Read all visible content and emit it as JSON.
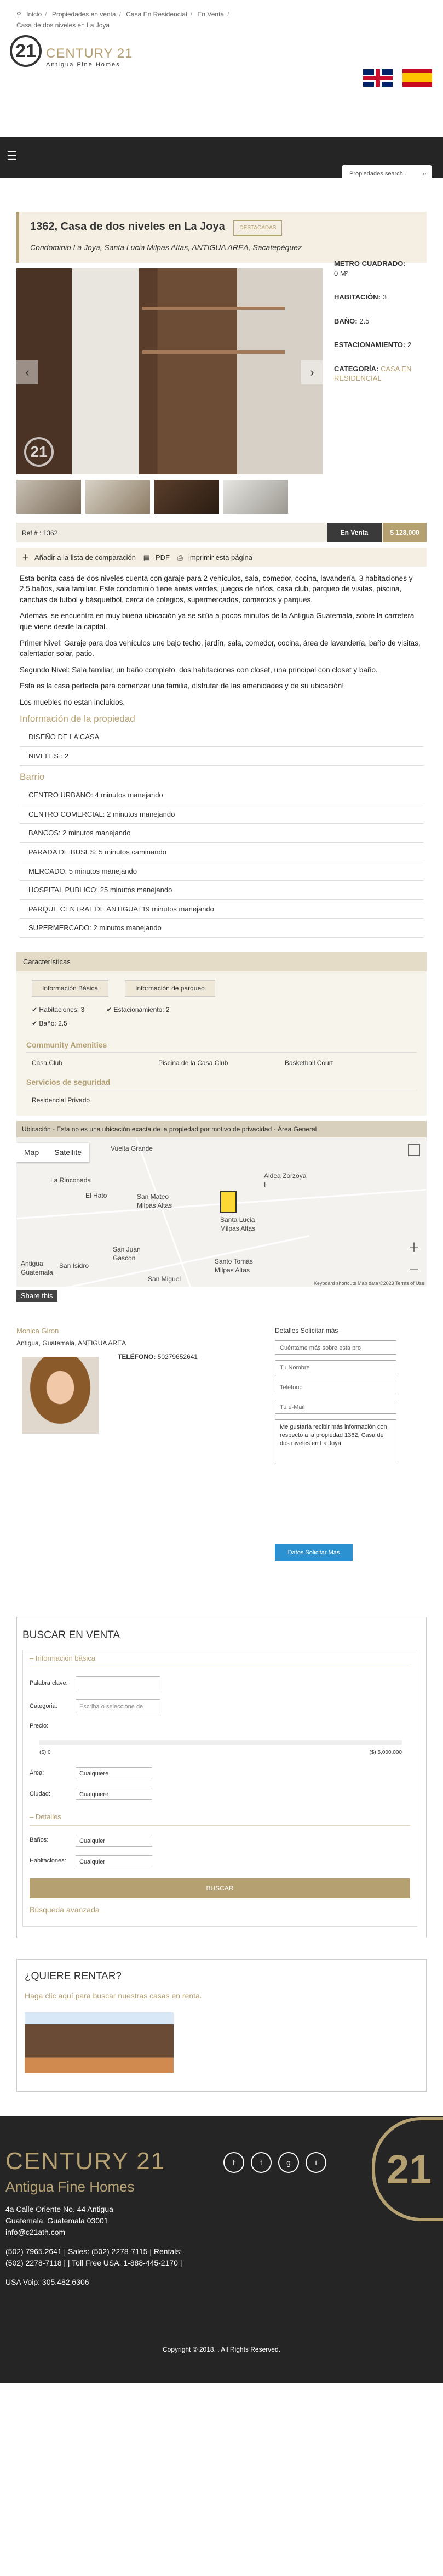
{
  "breadcrumb": {
    "home": "Inicio",
    "items": [
      "Propiedades en venta",
      "Casa En Residencial",
      "En Venta"
    ],
    "current": "Casa de dos niveles en La Joya"
  },
  "header": {
    "logo_mark": "21",
    "logo_text": "CENTURY 21",
    "logo_sub": "Antigua Fine Homes"
  },
  "nav": {
    "search_placeholder": "Propiedades search..."
  },
  "property": {
    "title": "1362,  Casa de dos niveles en La Joya",
    "badge": "DESTACADAS",
    "address": "Condominio La Joya, Santa Lucia Milpas Altas, ANTIGUA AREA, Sacatepéquez",
    "specs": [
      {
        "label": "METRO CUADRADO:",
        "value": "0 M²"
      },
      {
        "label": "HABITACIÓN:",
        "value": "3"
      },
      {
        "label": "BAÑO:",
        "value": "2.5"
      },
      {
        "label": "ESTACIONAMIENTO:",
        "value": "2"
      },
      {
        "label": "CATEGORÍA:",
        "value": "CASA EN RESIDENCIAL"
      }
    ],
    "ref": "Ref # : 1362",
    "status": "En Venta",
    "price": "$ 128,000",
    "actions": [
      "Añadir a la lista de comparación",
      "PDF",
      "imprimir esta página"
    ]
  },
  "description": [
    "Esta bonita casa de dos niveles cuenta con garaje para 2 vehículos, sala, comedor, cocina, lavandería, 3 habitaciones y 2.5 baños, sala familiar. Este condominio tiene áreas verdes, juegos de niños, casa club, parqueo de visitas, piscina, canchas de futbol y básquetbol, cerca de colegios, supermercados, comercios y parques.",
    "Además, se encuentra en muy buena ubicación ya se sitúa a pocos minutos de la Antigua Guatemala, sobre la carretera que viene desde la capital.",
    "Primer Nivel: Garaje para dos vehículos une bajo techo, jardín, sala, comedor, cocina, área de lavandería, baño de visitas, calentador solar, patio.",
    "Segundo Nivel: Sala familiar, un baño completo, dos habitaciones con closet, una principal con closet y baño.",
    "Esta es la casa perfecta para comenzar una familia, disfrutar de las amenidades y de su ubicación!",
    "Los muebles no estan incluidos."
  ],
  "info": {
    "heading": "Información de la propiedad",
    "rows": [
      {
        "k": "DISEÑO DE LA CASA",
        "v": ""
      },
      {
        "k": "NIVELES :",
        "v": "2"
      }
    ]
  },
  "barrio": {
    "heading": "Barrio",
    "rows": [
      {
        "k": "CENTRO URBANO:",
        "v": "4 minutos manejando"
      },
      {
        "k": "CENTRO COMERCIAL:",
        "v": "2 minutos manejando"
      },
      {
        "k": "BANCOS:",
        "v": "2 minutos manejando"
      },
      {
        "k": "PARADA DE BUSES:",
        "v": "5 minutos caminando"
      },
      {
        "k": "MERCADO:",
        "v": "5 minutos manejando"
      },
      {
        "k": "HOSPITAL PUBLICO:",
        "v": "25 minutos manejando"
      },
      {
        "k": "PARQUE CENTRAL DE ANTIGUA:",
        "v": "19 minutos manejando"
      },
      {
        "k": "SUPERMERCADO:",
        "v": "2 minutos manejando"
      }
    ]
  },
  "features": {
    "heading": "Características",
    "tabs": [
      "Información Básica",
      "Información de parqueo"
    ],
    "basic": [
      "Habitaciones: 3",
      "Baño: 2.5"
    ],
    "parking": [
      "Estacionamiento: 2"
    ],
    "amenities_heading": "Community Amenities",
    "amenities": [
      "Casa Club",
      "Piscina de la Casa Club",
      "Basketball Court"
    ],
    "security_heading": "Servicios de seguridad",
    "security": [
      "Residencial Privado"
    ]
  },
  "location": {
    "heading": "Ubicación - Esta no es una ubicación exacta de la propiedad por motivo de privacidad - Área General",
    "map_btn": "Map",
    "sat_btn": "Satellite",
    "labels": [
      "Vuelta Grande",
      "La Rinconada",
      "El Hato",
      "San Mateo Milpas Altas",
      "Santa Lucia Milpas Altas",
      "Aldea Zorzoya I",
      "San Juan Gascon",
      "San Miguel",
      "Santo Tomás Milpas Altas",
      "Antigua Guatemala",
      "San Isidro"
    ],
    "attribution": "Keyboard shortcuts   Map data ©2023   Terms of Use",
    "share": "Share this"
  },
  "agent": {
    "name": "Monica Giron",
    "location": "Antigua, Guatemala, ANTIGUA AREA",
    "tel_label": "TELÉFONO:",
    "tel": "50279652641",
    "form_heading": "Detalles Solicitar más",
    "select_value": "Cuéntame más sobre esta pro",
    "name_ph": "Tu Nombre",
    "phone_ph": "Teléfono",
    "email_ph": "Tu e-Mail",
    "message": "Me gustaría recibir más información con respecto a la propiedad 1362, Casa de dos niveles en La Joya",
    "send": "Datos Solicitar Más"
  },
  "buscar": {
    "title": "BUSCAR EN VENTA",
    "basic": "Información básica",
    "keyword_label": "Palabra clave:",
    "category_label": "Categoria:",
    "category_ph": "Escriba o seleccione de",
    "price_label": "Precio:",
    "price_min": "($) 0",
    "price_max": "($) 5,000,000",
    "area_label": "Área:",
    "area_value": "Cualquiere",
    "city_label": "Ciudad:",
    "city_value": "Cualquiere",
    "details": "Detalles",
    "baths_label": "Baños:",
    "baths_value": "Cualquier",
    "rooms_label": "Habitaciones:",
    "rooms_value": "Cualquier",
    "button": "BUSCAR",
    "advanced": "Búsqueda avanzada"
  },
  "rentar": {
    "title": "¿QUIERE RENTAR?",
    "link": "Haga clic aquí para buscar nuestras casas en renta."
  },
  "footer": {
    "logo": "CENTURY 21",
    "sub": "Antigua Fine Homes",
    "big": "21",
    "social": [
      "f",
      "t",
      "g",
      "i"
    ],
    "lines": [
      "4a Calle Oriente No. 44 Antigua",
      "Guatemala, Guatemala 03001",
      "info@c21ath.com"
    ],
    "phones": [
      "(502) 7965.2641 | Sales: (502) 2278-7115 | Rentals:",
      "(502) 2278-7118 | | Toll Free USA: 1-888-445-2170 |",
      "USA Voip: 305.482.6306"
    ],
    "copyright": "Copyright © 2018. . All Rights Reserved."
  }
}
